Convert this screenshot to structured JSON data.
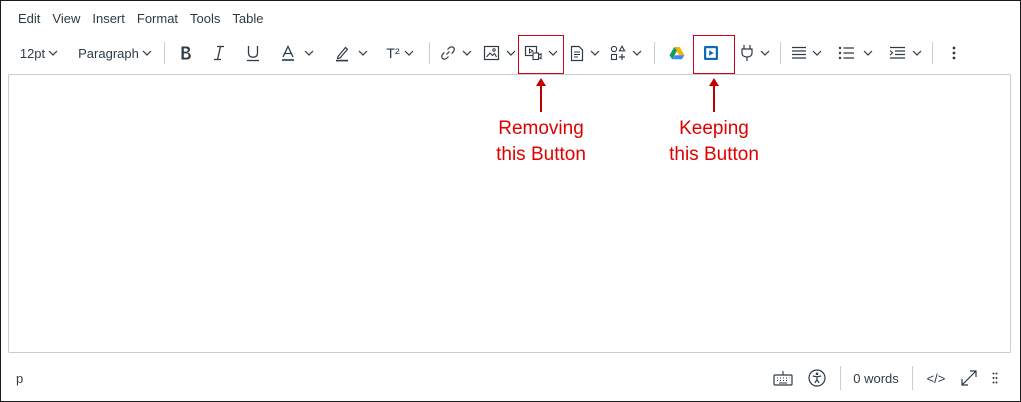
{
  "menubar": {
    "items": [
      "Edit",
      "View",
      "Insert",
      "Format",
      "Tools",
      "Table"
    ]
  },
  "toolbar": {
    "font_size": "12pt",
    "block_format": "Paragraph",
    "superscript_label": "T²",
    "icons": [
      "bold-icon",
      "italic-icon",
      "underline-icon",
      "text-color-icon",
      "highlight-icon",
      "superscript-icon",
      "link-icon",
      "image-icon",
      "media-icon",
      "document-icon",
      "apps-icon",
      "google-drive-icon",
      "embed-media-icon",
      "plugin-icon",
      "align-icon",
      "list-icon",
      "indent-icon",
      "more-icon"
    ]
  },
  "annotations": {
    "removing": {
      "line1": "Removing",
      "line2": "this Button"
    },
    "keeping": {
      "line1": "Keeping",
      "line2": "this Button"
    }
  },
  "statusbar": {
    "path": "p",
    "word_count": "0 words",
    "html_toggle": "</>"
  },
  "colors": {
    "annotation_red": "#d0021b",
    "toolbar_text": "#2d3b45",
    "drive_yellow": "#f4b400",
    "drive_green": "#0f9d58",
    "drive_blue": "#4285f4",
    "embed_blue": "#0b6bb8"
  }
}
